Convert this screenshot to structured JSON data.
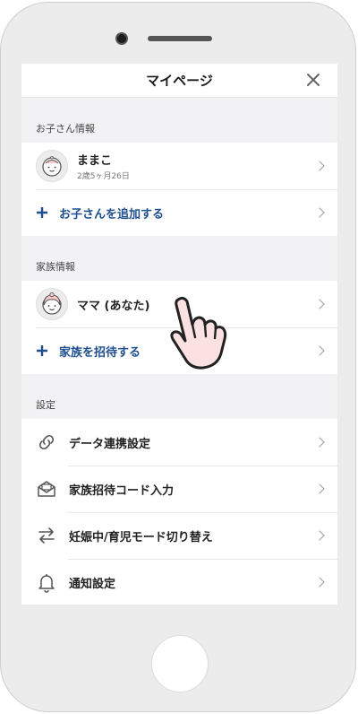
{
  "header": {
    "title": "マイページ"
  },
  "children": {
    "section_label": "お子さん情報",
    "child": {
      "name": "ままこ",
      "age": "2歳5ヶ月26日"
    },
    "add_label": "お子さんを追加する"
  },
  "family": {
    "section_label": "家族情報",
    "member": {
      "name": "ママ (あなた)"
    },
    "invite_label": "家族を招待する"
  },
  "settings": {
    "section_label": "設定",
    "items": [
      {
        "label": "データ連携設定",
        "icon": "link-icon"
      },
      {
        "label": "家族招待コード入力",
        "icon": "mail-open-icon"
      },
      {
        "label": "妊娠中/育児モード切り替え",
        "icon": "swap-arrows-icon"
      },
      {
        "label": "通知設定",
        "icon": "bell-icon"
      }
    ]
  },
  "colors": {
    "accent": "#1f4f8f",
    "background": "#f2f2f4",
    "avatar_pink": "#f6c9c9"
  }
}
